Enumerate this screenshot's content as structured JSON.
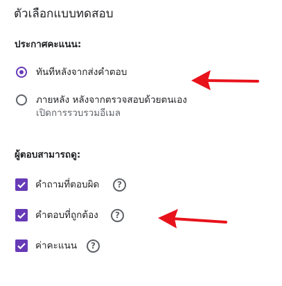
{
  "title": "ตัวเลือกแบบทดสอบ",
  "release_grade": {
    "heading": "ประกาศคะแนน:",
    "options": [
      {
        "label": "ทันทีหลังจากส่งคำตอบ",
        "selected": true
      },
      {
        "label": "ภายหลัง หลังจากตรวจสอบด้วยตนเอง",
        "sublabel": "เปิดการรวบรวมอีเมล",
        "selected": false
      }
    ]
  },
  "respondents_can_see": {
    "heading": "ผู้ตอบสามารถดู:",
    "items": [
      {
        "label": "คำถามที่ตอบผิด",
        "checked": true
      },
      {
        "label": "คำตอบที่ถูกต้อง",
        "checked": true
      },
      {
        "label": "ค่าคะแนน",
        "checked": true
      }
    ]
  },
  "help_icon_glyph": "?",
  "colors": {
    "accent": "#673ab7",
    "annotation_arrow": "#e8121b",
    "text_primary": "#202124",
    "text_secondary": "#5f6368"
  }
}
